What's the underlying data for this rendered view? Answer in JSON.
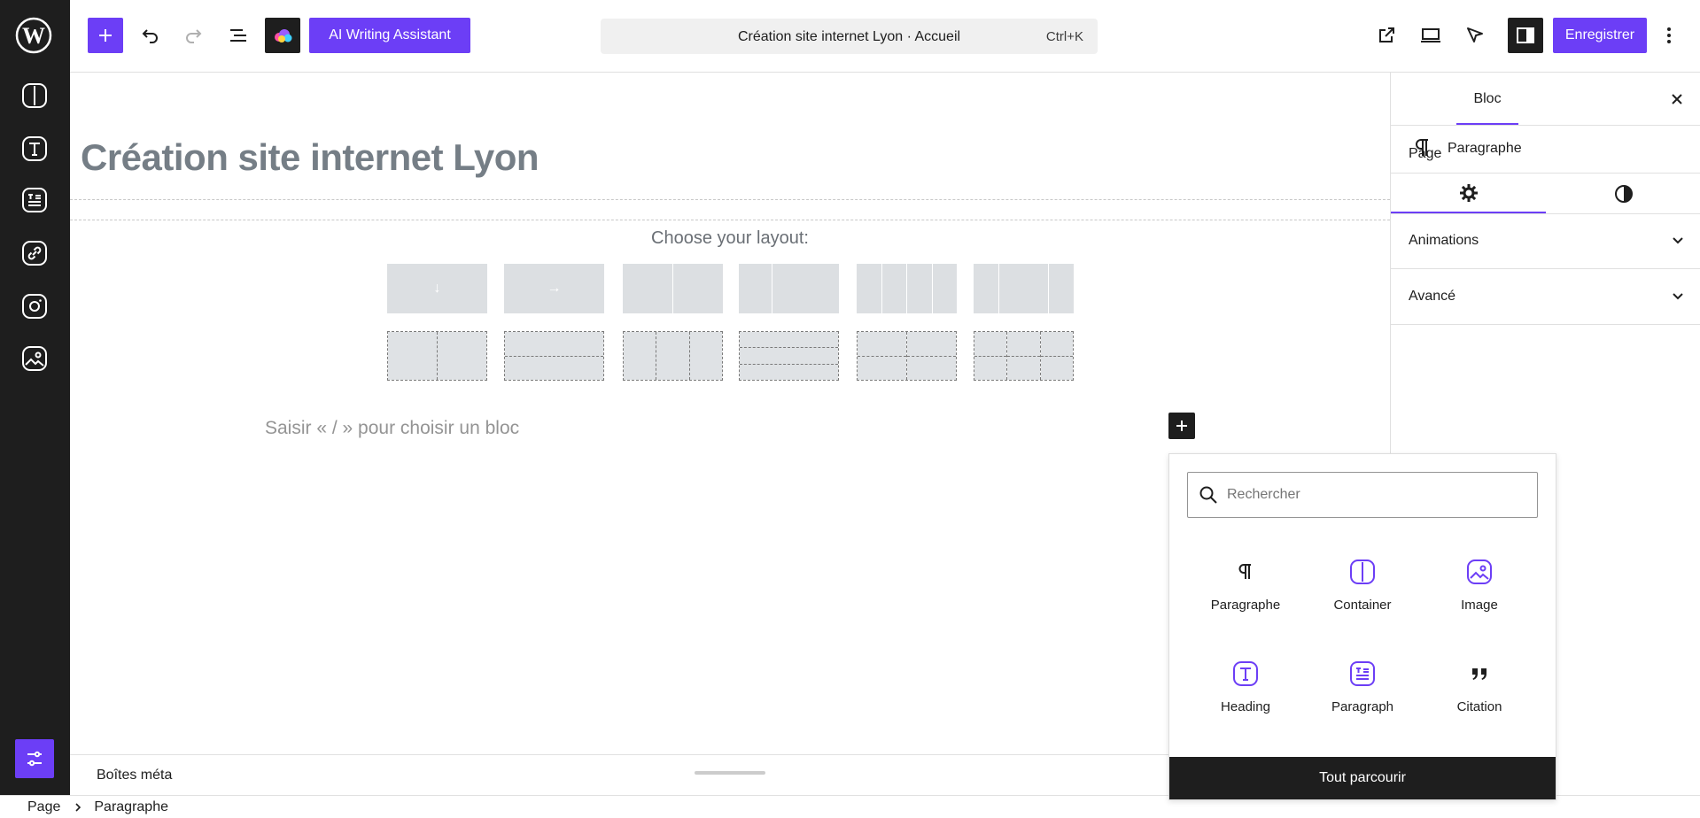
{
  "colors": {
    "accent": "#6c3ef6",
    "dark": "#1e1e1e"
  },
  "toolbar": {
    "ai_label": "AI Writing Assistant",
    "doc_title": "Création site internet Lyon · Accueil",
    "shortcut": "Ctrl+K",
    "save_label": "Enregistrer"
  },
  "sidebar_icons": [
    "columns-icon",
    "heading-icon",
    "post-list-icon",
    "link-icon",
    "instagram-icon",
    "image-icon"
  ],
  "editor": {
    "title": "Création site internet Lyon",
    "layout_label": "Choose your layout:",
    "placeholder": "Saisir « / » pour choisir un bloc"
  },
  "settings": {
    "tab_page": "Page",
    "tab_block": "Bloc",
    "block_name": "Paragraphe",
    "panels": [
      "Animations",
      "Avancé"
    ]
  },
  "inserter": {
    "search_placeholder": "Rechercher",
    "items": [
      {
        "label": "Paragraphe",
        "icon": "pilcrow-icon"
      },
      {
        "label": "Container",
        "icon": "container-icon"
      },
      {
        "label": "Image",
        "icon": "image-icon"
      },
      {
        "label": "Heading",
        "icon": "heading-icon"
      },
      {
        "label": "Paragraph",
        "icon": "paragraph-block-icon"
      },
      {
        "label": "Citation",
        "icon": "quote-icon"
      }
    ],
    "browse_all": "Tout parcourir"
  },
  "meta": {
    "label": "Boîtes méta"
  },
  "breadcrumb": [
    "Page",
    "Paragraphe"
  ]
}
